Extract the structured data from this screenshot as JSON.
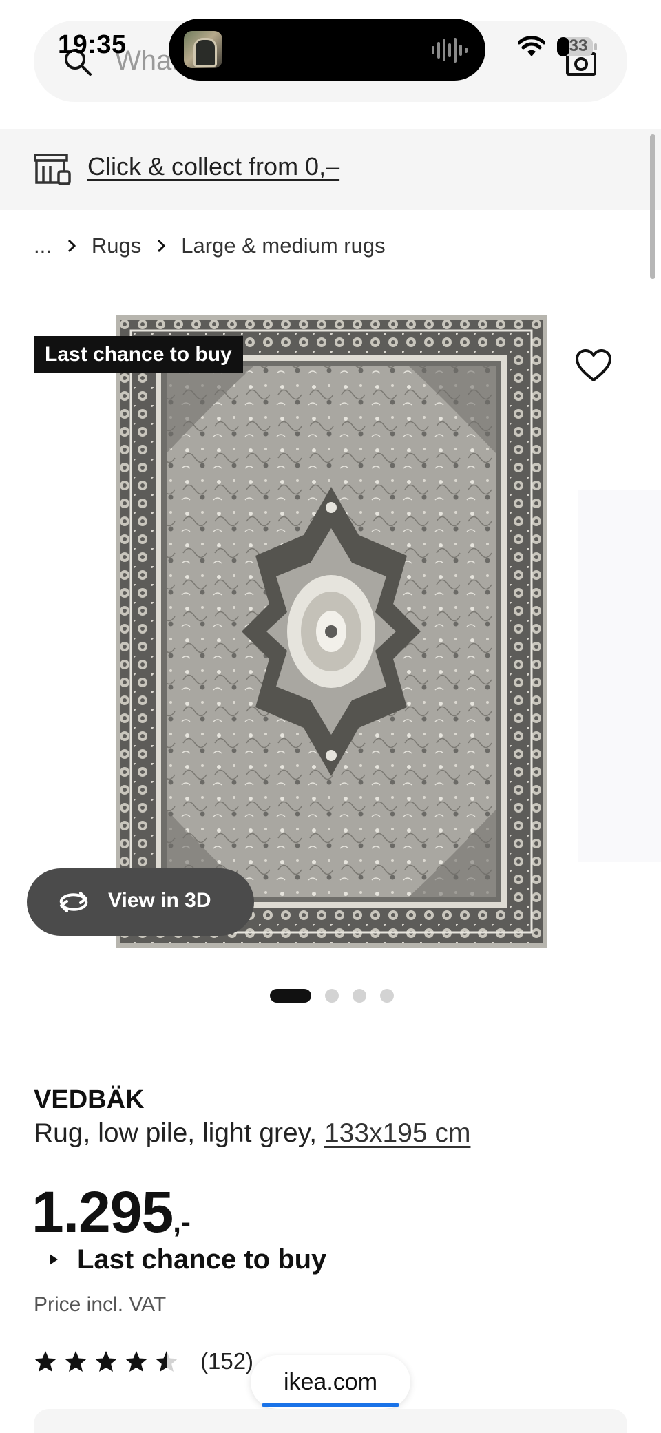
{
  "status_bar": {
    "time": "19:35",
    "battery": "33"
  },
  "search": {
    "placeholder": "What are you looking for?"
  },
  "collect": {
    "label": "Click & collect from 0,–"
  },
  "breadcrumb": {
    "ellipsis": "...",
    "items": [
      "Rugs",
      "Large & medium rugs"
    ]
  },
  "image": {
    "badge": "Last chance to buy",
    "view3d_label": "View in 3D",
    "slide_count": 4,
    "active_slide": 1
  },
  "product": {
    "name": "VEDBÄK",
    "description": "Rug, low pile, light grey, ",
    "size": "133x195 cm",
    "price": "1.295",
    "price_suffix": ",-",
    "offer_label": "Last chance to buy",
    "vat_note": "Price incl. VAT",
    "rating": 4.5,
    "review_count": "(152)"
  },
  "browser": {
    "url": "ikea.com"
  },
  "colors": {
    "rug_mid": "#a9a7a1",
    "rug_dark": "#5d5c59",
    "rug_light": "#e6e4dd",
    "badge_bg": "#111111",
    "view3d_bg": "#4b4b4b",
    "progress": "#1a73e8"
  }
}
